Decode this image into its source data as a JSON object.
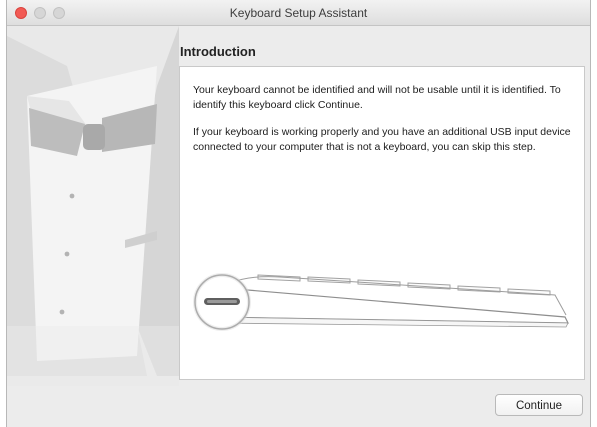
{
  "window": {
    "title": "Keyboard Setup Assistant"
  },
  "main": {
    "heading": "Introduction",
    "paragraph_1": "Your keyboard cannot be identified and will not be usable until it is identified. To identify this keyboard click Continue.",
    "paragraph_2": "If your keyboard is working properly and you have an additional USB input device connected to your computer that is not a keyboard, you can skip this step."
  },
  "footer": {
    "continue_label": "Continue"
  },
  "icons": {
    "sidebar": "bow-tie-tuxedo-illustration",
    "keyboard": "keyboard-illustration"
  },
  "colors": {
    "close_button": "#f25a54",
    "window_background": "#ececec",
    "panel_background": "#ffffff"
  }
}
